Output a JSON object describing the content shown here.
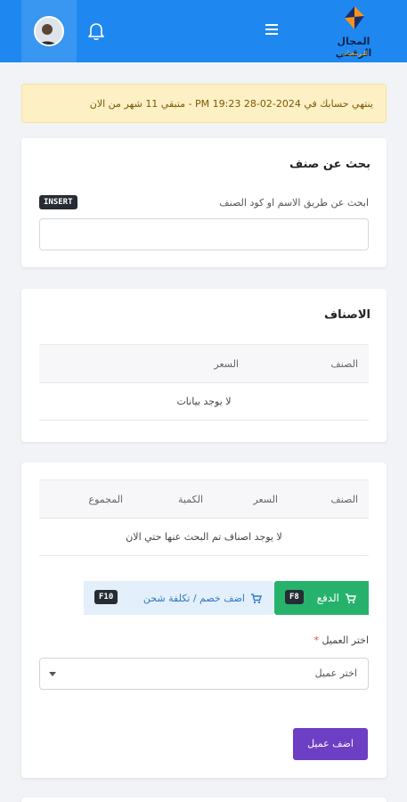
{
  "header": {
    "brand_name": "المجال الرقمي",
    "brand_sub": "للبرمجيات",
    "icons": {
      "menu": "hamburger-menu-icon",
      "bell": "notification-bell-icon",
      "avatar": "user-avatar"
    }
  },
  "alert": {
    "text": "ينتهي حسابك في 2024-02-28 PM 19:23 - متبقي 11 شهر من الان"
  },
  "search_card": {
    "title": "بحث عن صنف",
    "hint": "ابحث عن طريق الاسم او كود الصنف",
    "shortcut": "INSERT",
    "input_value": ""
  },
  "products_card": {
    "title": "الاصناف",
    "columns": [
      "الصنف",
      "السعر"
    ],
    "empty_text": "لا يوجد بيانات"
  },
  "cart_card": {
    "columns": [
      "الصنف",
      "السعر",
      "الكمية",
      "المجموع"
    ],
    "empty_text": "لا يوجد اصناف تم البحث عنها حتي الان",
    "pay_button": {
      "label": "الدفع",
      "shortcut": "F8"
    },
    "discount_button": {
      "label": "اضف خصم / تكلفة شحن",
      "shortcut": "F10"
    },
    "client_label": "اختر العميل",
    "required_mark": "*",
    "client_select_value": "اختر عميل",
    "add_client_label": "اضف عميل"
  },
  "colors": {
    "topbar": "#1e88f0",
    "alert_bg": "#fdf0c4",
    "pay": "#27b26c",
    "discount_bg": "#e3effb",
    "add_client": "#6c3fc4"
  }
}
